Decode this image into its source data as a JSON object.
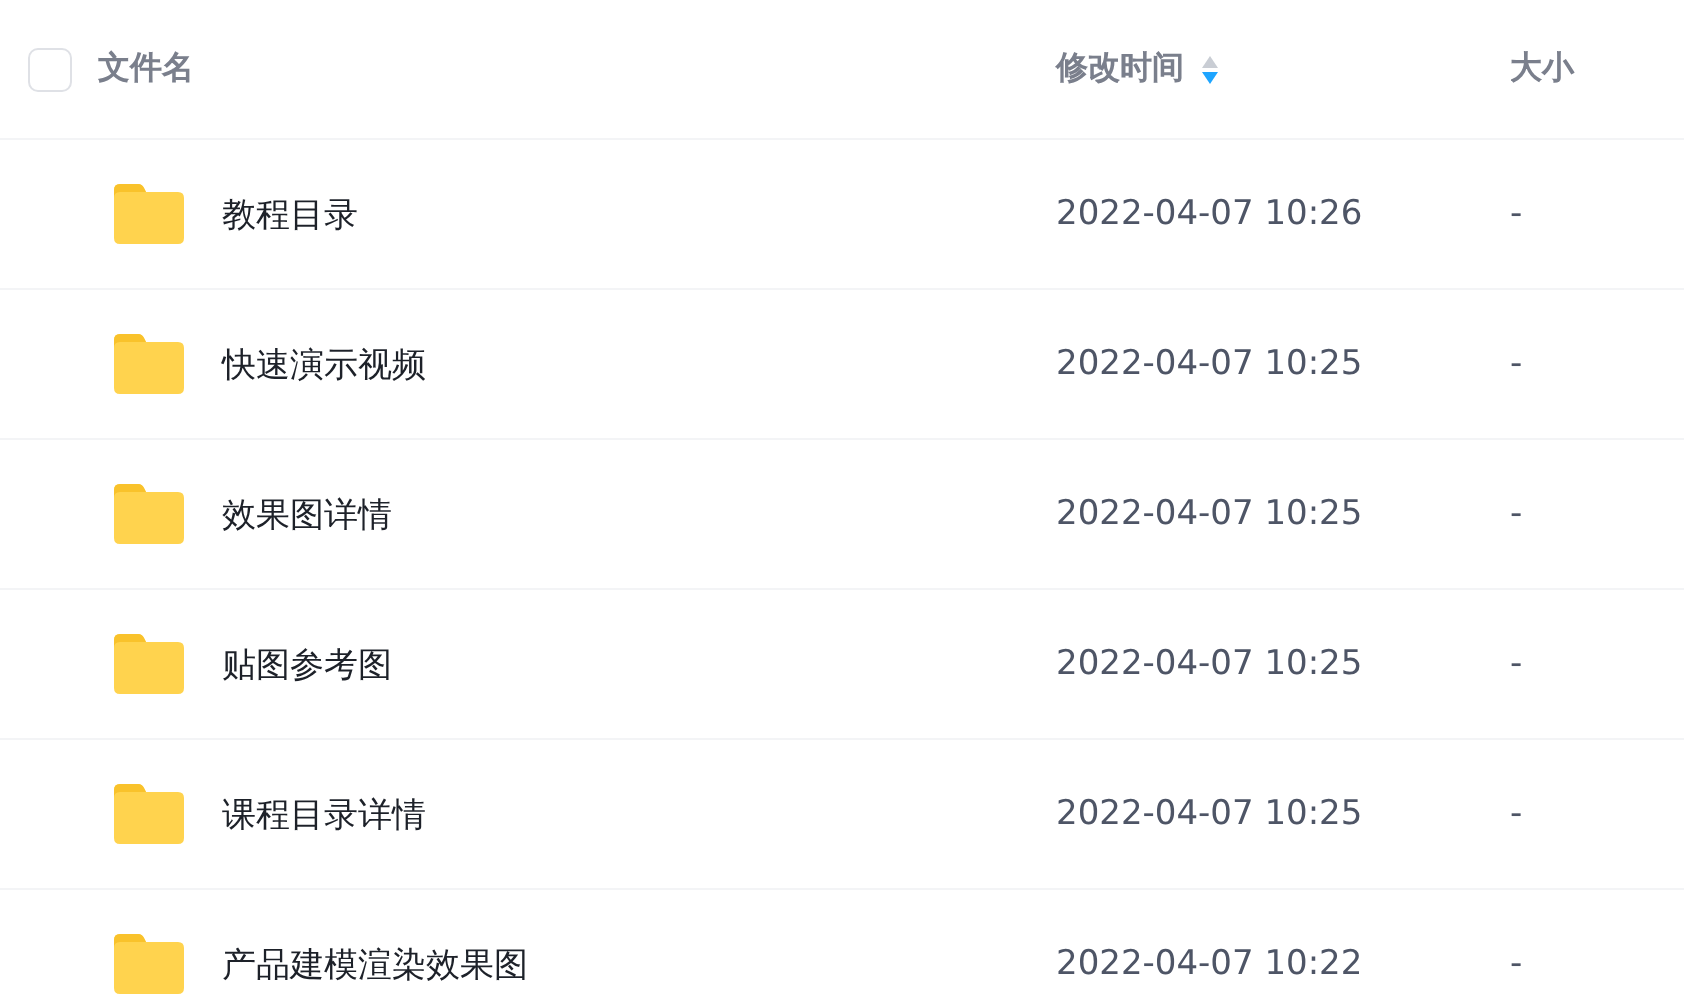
{
  "header": {
    "select_all": {
      "checked": false
    },
    "columns": [
      {
        "label": "文件名"
      },
      {
        "label": "修改时间",
        "sort_descending": true
      },
      {
        "label": "大小"
      }
    ]
  },
  "rows": [
    {
      "name": "教程目录",
      "modified": "2022-04-07 10:26",
      "size": "-"
    },
    {
      "name": "快速演示视频",
      "modified": "2022-04-07 10:25",
      "size": "-"
    },
    {
      "name": "效果图详情",
      "modified": "2022-04-07 10:25",
      "size": "-"
    },
    {
      "name": "贴图参考图",
      "modified": "2022-04-07 10:25",
      "size": "-"
    },
    {
      "name": "课程目录详情",
      "modified": "2022-04-07 10:25",
      "size": "-"
    },
    {
      "name": "产品建模渲染效果图",
      "modified": "2022-04-07 10:22",
      "size": "-"
    }
  ]
}
